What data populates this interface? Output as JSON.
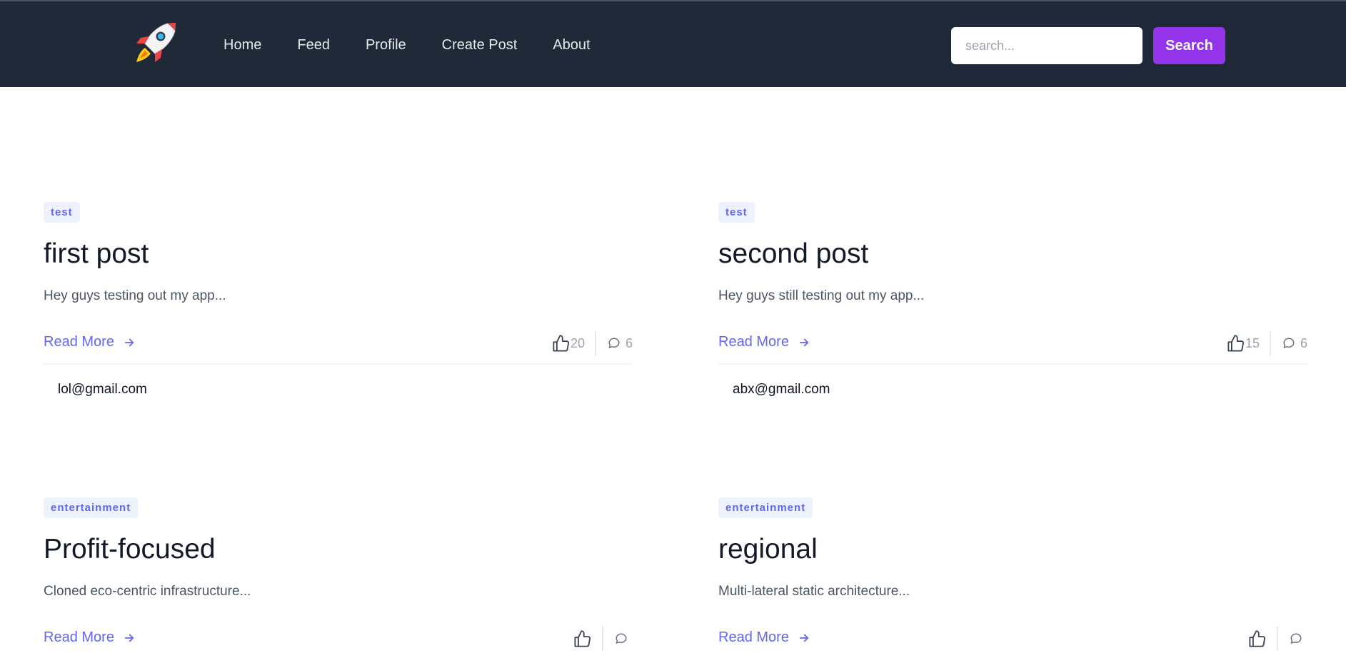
{
  "nav": {
    "links": [
      "Home",
      "Feed",
      "Profile",
      "Create Post",
      "About"
    ]
  },
  "search": {
    "placeholder": "search...",
    "button_label": "Search"
  },
  "colors": {
    "navbar": "#1f2937",
    "accent": "#9333ea",
    "link": "#6366f1",
    "tag_bg": "#eef2ff"
  },
  "posts": [
    {
      "tag": "test",
      "title": "first post",
      "excerpt": "Hey guys testing out my app...",
      "read_more": "Read More",
      "likes": "20",
      "comments": "6",
      "author": "lol@gmail.com"
    },
    {
      "tag": "test",
      "title": "second post",
      "excerpt": "Hey guys still testing out my app...",
      "read_more": "Read More",
      "likes": "15",
      "comments": "6",
      "author": "abx@gmail.com"
    },
    {
      "tag": "entertainment",
      "title": "Profit-focused",
      "excerpt": "Cloned eco-centric infrastructure...",
      "read_more": "Read More"
    },
    {
      "tag": "entertainment",
      "title": "regional",
      "excerpt": "Multi-lateral static architecture...",
      "read_more": "Read More"
    }
  ]
}
